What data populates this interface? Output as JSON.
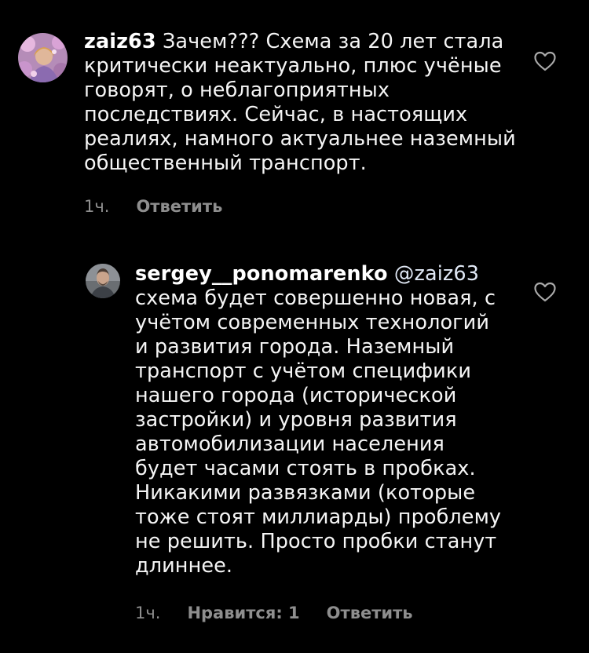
{
  "colors": {
    "background": "#000000",
    "text": "#f5f5f5",
    "meta": "#8e8e8e"
  },
  "comments": [
    {
      "username": "zaiz63",
      "text": "Зачем??? Схема за 20 лет стала критически неактуально, плюс учёные говорят, о неблагоприятных последствиях. Сейчас, в настоящих реалиях, намного актуальнее наземный общественный транспорт.",
      "time": "1ч.",
      "reply_label": "Ответить",
      "like_icon": "heart-icon"
    },
    {
      "username": "sergey__ponomarenko",
      "mention": "@zaiz63",
      "text": "схема будет совершенно новая, с учётом современных технологий и развития города. Наземный транспорт с учётом специфики нашего города (исторической застройки) и уровня развития автомобилизации населения будет часами стоять в пробках. Никакими развязками (которые тоже стоят миллиарды) проблему не решить. Просто пробки станут длиннее.",
      "time": "1ч.",
      "likes_label": "Нравится: 1",
      "reply_label": "Ответить",
      "like_icon": "heart-icon"
    }
  ]
}
